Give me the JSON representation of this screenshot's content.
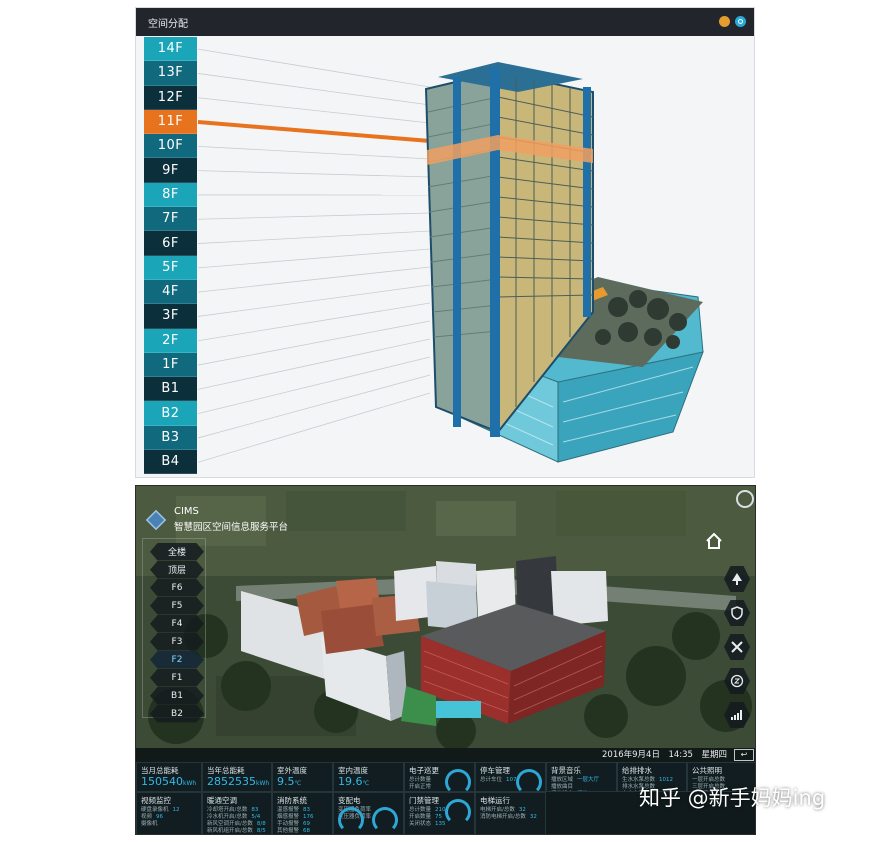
{
  "top_panel": {
    "title": "空间分配",
    "floors": [
      {
        "label": "14F",
        "color": "#1aa5b8"
      },
      {
        "label": "13F",
        "color": "#10697c"
      },
      {
        "label": "12F",
        "color": "#0c2f3c"
      },
      {
        "label": "11F",
        "color": "#e8731f"
      },
      {
        "label": "10F",
        "color": "#10697c"
      },
      {
        "label": "9F",
        "color": "#0c2f3c"
      },
      {
        "label": "8F",
        "color": "#1aa5b8"
      },
      {
        "label": "7F",
        "color": "#10697c"
      },
      {
        "label": "6F",
        "color": "#0c2f3c"
      },
      {
        "label": "5F",
        "color": "#1aa5b8"
      },
      {
        "label": "4F",
        "color": "#10697c"
      },
      {
        "label": "3F",
        "color": "#0c2f3c"
      },
      {
        "label": "2F",
        "color": "#1aa5b8"
      },
      {
        "label": "1F",
        "color": "#10697c"
      },
      {
        "label": "B1",
        "color": "#0c2f3c"
      },
      {
        "label": "B2",
        "color": "#1aa5b8"
      },
      {
        "label": "B3",
        "color": "#10697c"
      },
      {
        "label": "B4",
        "color": "#0c2f3c"
      }
    ],
    "selected_floor": "11F",
    "icons": [
      "minimize-icon",
      "refresh-icon"
    ]
  },
  "bottom_panel": {
    "brand_code": "CIMS",
    "brand_name": "智慧园区空间信息服务平台",
    "floor_nav": [
      {
        "label": "全楼"
      },
      {
        "label": "顶层"
      },
      {
        "label": "F6"
      },
      {
        "label": "F5"
      },
      {
        "label": "F4"
      },
      {
        "label": "F3"
      },
      {
        "label": "F2",
        "active": true
      },
      {
        "label": "F1"
      },
      {
        "label": "B1"
      },
      {
        "label": "B2"
      }
    ],
    "datetime": "2016年9月4日　14:35　星期四",
    "back_label": "↩",
    "side_icons": [
      "home-icon",
      "tree-icon",
      "shield-icon",
      "tools-icon",
      "clock-24-icon",
      "chart-icon"
    ],
    "dashboard": {
      "energy_month": {
        "title": "当月总能耗",
        "value": "150540",
        "unit": "kWh"
      },
      "energy_year": {
        "title": "当年总能耗",
        "value": "2852535",
        "unit": "kWh"
      },
      "outdoor_temp": {
        "title": "室外温度",
        "value": "9.5",
        "unit": "℃"
      },
      "indoor_temp": {
        "title": "室内温度",
        "value": "19.6",
        "unit": "℃"
      },
      "electronic_patrol": {
        "title": "电子巡更",
        "lines": [
          {
            "label": "总计数量",
            "value": ""
          },
          {
            "label": "开启正常",
            "value": ""
          }
        ]
      },
      "parking": {
        "title": "停车管理",
        "lines": [
          {
            "label": "总计车位",
            "value": "107"
          }
        ]
      },
      "background_music": {
        "title": "背景音乐",
        "lines": [
          {
            "label": "播放区域",
            "value": "一层大厅"
          },
          {
            "label": "播放曲目",
            "value": ""
          },
          {
            "label": "播放状态",
            "value": "播放"
          }
        ]
      },
      "water_supply": {
        "title": "给排排水",
        "lines": [
          {
            "label": "生水水泵总数",
            "value": "1012"
          },
          {
            "label": "排水水泵总数",
            "value": ""
          },
          {
            "label": "中水水泵总数",
            "value": ""
          },
          {
            "label": "废水水泵总数",
            "value": ""
          }
        ]
      },
      "public_lighting": {
        "title": "公共照明",
        "lines": [
          {
            "label": "一层开启总数",
            "value": ""
          },
          {
            "label": "三层开启总数",
            "value": ""
          },
          {
            "label": "五层开启总数",
            "value": ""
          },
          {
            "label": "六层开启总数",
            "value": "5228"
          }
        ]
      },
      "video_monitoring": {
        "title": "视频监控",
        "lines": [
          {
            "label": "硬盘录像机",
            "value": "12"
          },
          {
            "label": "视频",
            "value": "96"
          },
          {
            "label": "摄像机",
            "value": ""
          }
        ]
      },
      "hvac": {
        "title": "暖通空调",
        "lines": [
          {
            "label": "冷却塔开启/总数",
            "value": "83"
          },
          {
            "label": "冷水机开启/总数",
            "value": "5/4"
          },
          {
            "label": "新风空调开启/总数",
            "value": "8/8"
          },
          {
            "label": "新风机组开启/总数",
            "value": "8/5"
          }
        ]
      },
      "fire_system": {
        "title": "消防系统",
        "lines": [
          {
            "label": "温感报警",
            "value": "83"
          },
          {
            "label": "烟感报警",
            "value": "176"
          },
          {
            "label": "手动报警",
            "value": "69"
          },
          {
            "label": "其他报警",
            "value": "68"
          }
        ]
      },
      "power_distribution": {
        "title": "变配电",
        "lines": [
          {
            "label": "变压器负荷率",
            "value": ""
          },
          {
            "label": "变压器负荷率",
            "value": ""
          }
        ]
      },
      "access_control": {
        "title": "门禁管理",
        "lines": [
          {
            "label": "总计数量",
            "value": "210"
          },
          {
            "label": "开启数量",
            "value": "75"
          },
          {
            "label": "关闭状态",
            "value": "135"
          }
        ]
      },
      "elevator": {
        "title": "电梯运行",
        "lines": [
          {
            "label": "电梯开启/总数",
            "value": "32"
          },
          {
            "label": "消防电梯开启/总数",
            "value": "32"
          }
        ]
      }
    }
  },
  "watermark": "知乎 @新手妈妈ing"
}
